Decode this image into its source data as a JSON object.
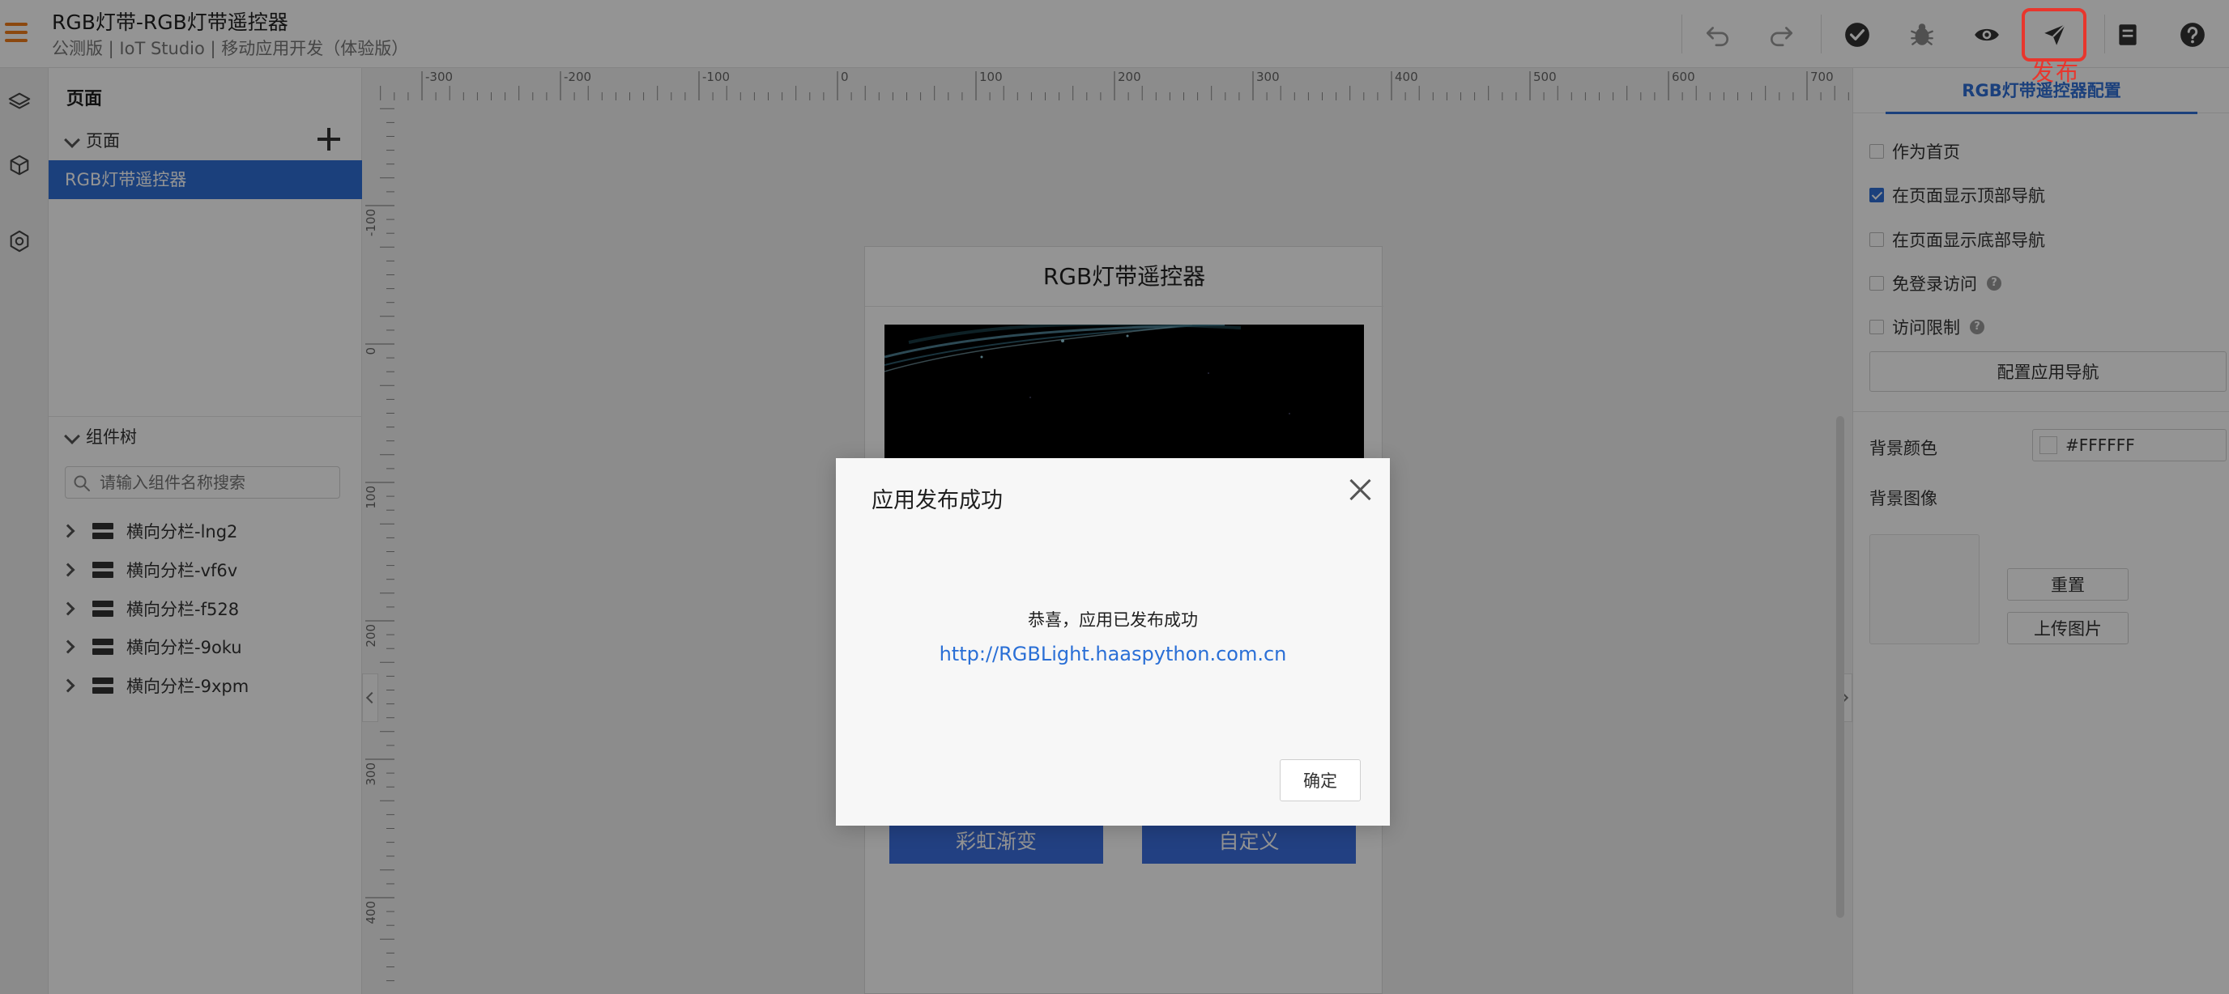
{
  "header": {
    "app_title": "RGB灯带-RGB灯带遥控器",
    "app_subtitle": "公测版 | IoT Studio | 移动应用开发（体验版）",
    "toolbar_icons": [
      "undo-icon",
      "redo-icon",
      "check-icon",
      "bug-icon",
      "eye-icon",
      "send-icon",
      "document-icon",
      "help-icon"
    ],
    "publish_caption": "发布"
  },
  "rail": {
    "icons": [
      "layers-icon",
      "cube-icon",
      "settings-icon"
    ]
  },
  "left_panel": {
    "title": "页面",
    "pages_header": "页面",
    "pages": [
      "RGB灯带遥控器"
    ],
    "tree_header": "组件树",
    "tree_search_placeholder": "请输入组件名称搜索",
    "tree_items": [
      "横向分栏-lng2",
      "横向分栏-vf6v",
      "横向分栏-f528",
      "横向分栏-9oku",
      "横向分栏-9xpm"
    ]
  },
  "canvas": {
    "ruler_h_labels": [
      "-300",
      "-200",
      "-100",
      "0",
      "100",
      "200",
      "300",
      "400",
      "500",
      "600",
      "700"
    ],
    "ruler_v_labels": [
      "-100",
      "0",
      "100",
      "200",
      "300",
      "400"
    ],
    "phone": {
      "title": "RGB灯带遥控器",
      "buttons": [
        "彩虹渐变",
        "自定义"
      ]
    }
  },
  "right_panel": {
    "tab": "RGB灯带遥控器配置",
    "checkboxes": [
      {
        "label": "作为首页",
        "checked": false,
        "help": false
      },
      {
        "label": "在页面显示顶部导航",
        "checked": true,
        "help": false
      },
      {
        "label": "在页面显示底部导航",
        "checked": false,
        "help": false
      },
      {
        "label": "免登录访问",
        "checked": false,
        "help": true
      },
      {
        "label": "访问限制",
        "checked": false,
        "help": true
      }
    ],
    "config_nav_button": "配置应用导航",
    "bg_color_label": "背景颜色",
    "bg_color_value": "#FFFFFF",
    "bg_image_label": "背景图像",
    "reset_button": "重置",
    "upload_button": "上传图片"
  },
  "modal": {
    "title": "应用发布成功",
    "message": "恭喜，应用已发布成功",
    "link": "http://RGBLight.haaspython.com.cn",
    "ok_button": "确定"
  },
  "colors": {
    "accent": "#2f6fd6",
    "highlight": "#e8362d",
    "menu": "#f07c1b",
    "phone_button": "#3b6fe0"
  }
}
